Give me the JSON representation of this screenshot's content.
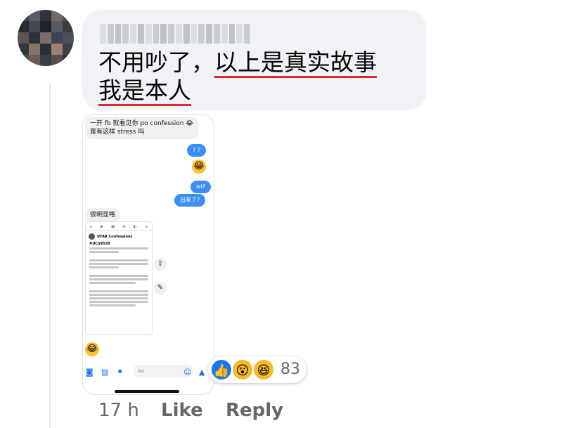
{
  "comment": {
    "line1_prefix": "不用吵了，",
    "line1_underlined": "以上是真实故事",
    "line2_underlined": "我是本人"
  },
  "screenshot": {
    "msg_in_1_line1": "一开 fb 就看见你 po confession 😂",
    "msg_in_1_line2": "是有这样 stress 吗",
    "msg_out_1": "? ?",
    "emoji_1": "😂",
    "msg_out_2": "wtf",
    "msg_out_3": "出来了?",
    "msg_in_2": "很明显咯",
    "post_page_name": "UTAR Confessions",
    "post_tag": "#UCS9538",
    "emoji_2": "😂",
    "composer_placeholder": "Aa",
    "share_icon": "⇪",
    "edit_icon": "✎"
  },
  "reactions": {
    "like_icon": "👍",
    "wow_icon": "😮",
    "haha_icon": "😆",
    "count": "83"
  },
  "actions": {
    "time": "17 h",
    "like": "Like",
    "reply": "Reply"
  },
  "colors": {
    "underline": "#e0282f",
    "bubble_bg": "#f0f2f5",
    "messenger_blue": "#3a8ff5",
    "fb_blue": "#1877f2",
    "meta_gray": "#65676b"
  }
}
